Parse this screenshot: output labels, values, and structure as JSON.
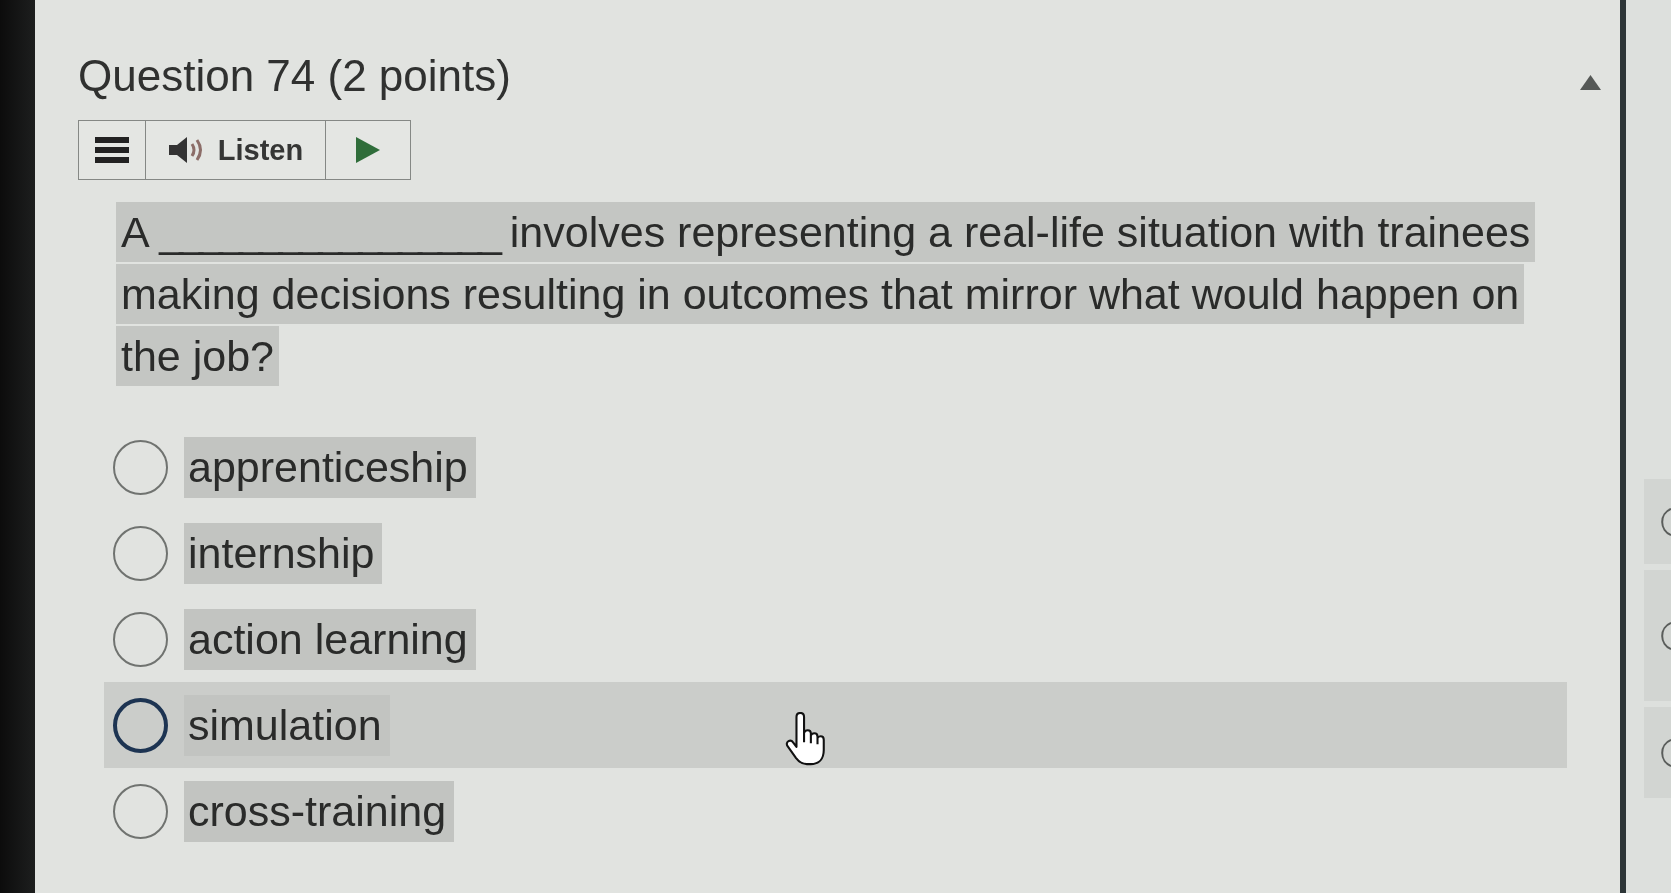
{
  "question_title": "Question 74 (2 points)",
  "listen_toolbar": {
    "label": "Listen"
  },
  "question_text": "A _________________ involves representing a real-life situation with trainees making decisions resulting in outcomes that mirror what would happen on the job?",
  "options": [
    {
      "label": "apprenticeship",
      "selected": false,
      "hovered": false
    },
    {
      "label": "internship",
      "selected": false,
      "hovered": false
    },
    {
      "label": "action learning",
      "selected": false,
      "hovered": false
    },
    {
      "label": "simulation",
      "selected": false,
      "hovered": true
    },
    {
      "label": "cross-training",
      "selected": false,
      "hovered": false
    }
  ]
}
